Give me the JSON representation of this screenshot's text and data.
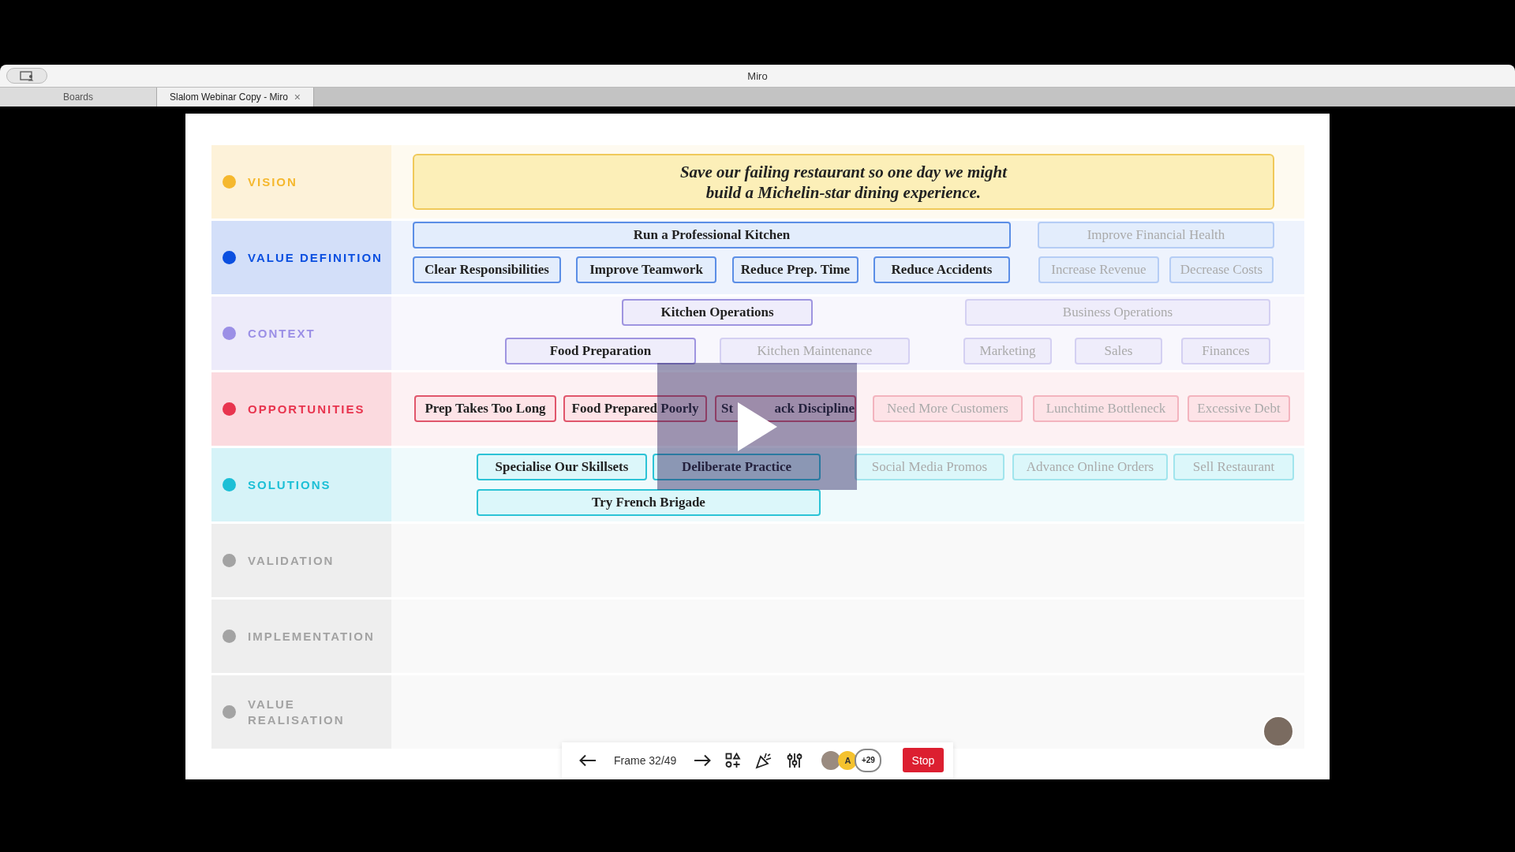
{
  "window": {
    "title": "Miro"
  },
  "tabs": [
    {
      "label": "Boards",
      "selected": false
    },
    {
      "label": "Slalom Webinar Copy - Miro",
      "selected": true,
      "close": "×"
    }
  ],
  "lanes": [
    {
      "label": "VISION",
      "color": "#f5b82e"
    },
    {
      "label": "VALUE DEFINITION",
      "color": "#0b4fe0"
    },
    {
      "label": "CONTEXT",
      "color": "#9b8fe6"
    },
    {
      "label": "OPPORTUNITIES",
      "color": "#e8344e"
    },
    {
      "label": "SOLUTIONS",
      "color": "#1bbfd6"
    },
    {
      "label": "VALIDATION",
      "color": "#a3a3a3"
    },
    {
      "label": "IMPLEMENTATION",
      "color": "#a3a3a3"
    },
    {
      "label": "VALUE REALISATION",
      "color": "#a3a3a3"
    }
  ],
  "vision": "Save our failing restaurant so one day we might build a Michelin-star dining experience.",
  "nodes": [
    {
      "text": "Run a Professional Kitchen",
      "kind": "value",
      "dimmed": false
    },
    {
      "text": "Improve Financial Health",
      "kind": "value",
      "dimmed": true
    },
    {
      "text": "Clear Responsibilities",
      "kind": "value",
      "dimmed": false
    },
    {
      "text": "Improve Teamwork",
      "kind": "value",
      "dimmed": false
    },
    {
      "text": "Reduce Prep. Time",
      "kind": "value",
      "dimmed": false
    },
    {
      "text": "Reduce Accidents",
      "kind": "value",
      "dimmed": false
    },
    {
      "text": "Increase Revenue",
      "kind": "value",
      "dimmed": true
    },
    {
      "text": "Decrease Costs",
      "kind": "value",
      "dimmed": true
    },
    {
      "text": "Kitchen Operations",
      "kind": "context",
      "dimmed": false
    },
    {
      "text": "Business Operations",
      "kind": "context",
      "dimmed": true
    },
    {
      "text": "Food Preparation",
      "kind": "context",
      "dimmed": false
    },
    {
      "text": "Kitchen Maintenance",
      "kind": "context",
      "dimmed": true
    },
    {
      "text": "Marketing",
      "kind": "context",
      "dimmed": true
    },
    {
      "text": "Sales",
      "kind": "context",
      "dimmed": true
    },
    {
      "text": "Finances",
      "kind": "context",
      "dimmed": true
    },
    {
      "text": "Prep Takes Too Long",
      "kind": "opportunity",
      "dimmed": false
    },
    {
      "text": "Food Prepared Poorly",
      "kind": "opportunity",
      "dimmed": false
    },
    {
      "text": "St",
      "text_after_gap": "ack Discipline",
      "kind": "opportunity",
      "dimmed": false
    },
    {
      "text": "Need More Customers",
      "kind": "opportunity",
      "dimmed": true
    },
    {
      "text": "Lunchtime Bottleneck",
      "kind": "opportunity",
      "dimmed": true
    },
    {
      "text": "Excessive Debt",
      "kind": "opportunity",
      "dimmed": true
    },
    {
      "text": "Specialise Our Skillsets",
      "kind": "solution",
      "dimmed": false
    },
    {
      "text": "Deliberate Practice",
      "kind": "solution",
      "dimmed": false
    },
    {
      "text": "Social Media Promos",
      "kind": "solution",
      "dimmed": true
    },
    {
      "text": "Advance Online Orders",
      "kind": "solution",
      "dimmed": true
    },
    {
      "text": "Sell Restaurant",
      "kind": "solution",
      "dimmed": true
    },
    {
      "text": "Try French Brigade",
      "kind": "solution",
      "dimmed": false
    }
  ],
  "toolbar": {
    "frame": "Frame 32/49",
    "avatar_initial": "A",
    "more_count": "+29",
    "stop": "Stop"
  }
}
